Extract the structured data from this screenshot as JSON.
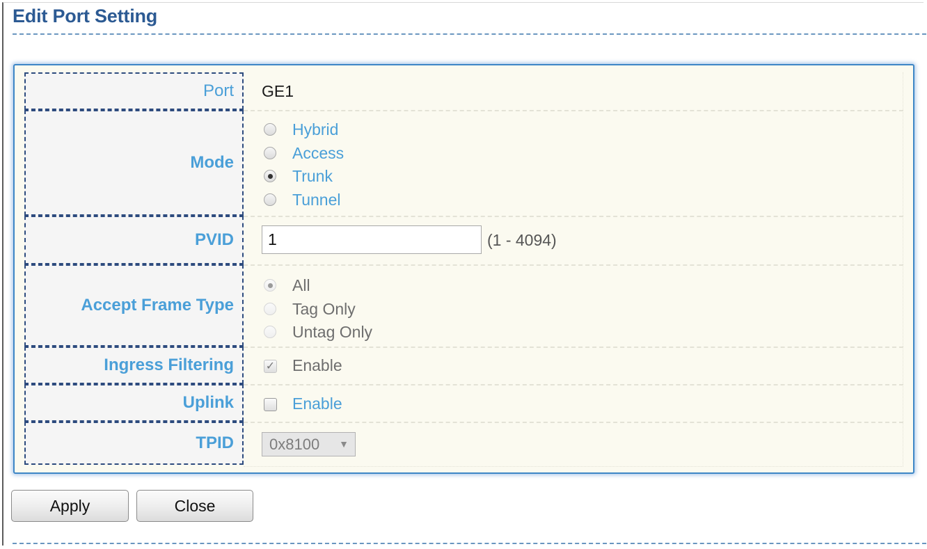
{
  "page": {
    "title": "Edit Port Setting"
  },
  "form": {
    "port": {
      "label": "Port",
      "value": "GE1"
    },
    "mode": {
      "label": "Mode",
      "options": [
        "Hybrid",
        "Access",
        "Trunk",
        "Tunnel"
      ],
      "selected": "Trunk"
    },
    "pvid": {
      "label": "PVID",
      "value": "1",
      "range": "(1 - 4094)"
    },
    "accept_frame_type": {
      "label": "Accept Frame Type",
      "options": [
        "All",
        "Tag Only",
        "Untag Only"
      ],
      "selected": "All",
      "disabled": true
    },
    "ingress_filtering": {
      "label": "Ingress Filtering",
      "option": "Enable",
      "checked": true,
      "disabled": true
    },
    "uplink": {
      "label": "Uplink",
      "option": "Enable",
      "checked": false
    },
    "tpid": {
      "label": "TPID",
      "value": "0x8100",
      "disabled": true
    }
  },
  "buttons": {
    "apply": "Apply",
    "close": "Close"
  },
  "colors": {
    "title": "#2c5a93",
    "label": "#4a9fd8",
    "panel_border": "#3d86c6",
    "panel_bg": "#fbfaf0"
  }
}
